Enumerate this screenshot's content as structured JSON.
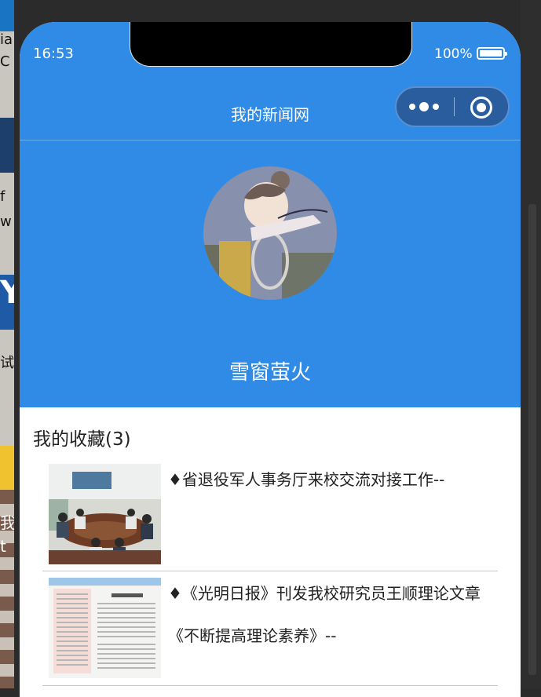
{
  "status_bar": {
    "time": "16:53",
    "battery": "100%"
  },
  "nav": {
    "title": "我的新闻网"
  },
  "profile": {
    "username": "雪窗萤火"
  },
  "favorites": {
    "title": "我的收藏(3)",
    "items": [
      {
        "title": "♦省退役军人事务厅来校交流对接工作--"
      },
      {
        "title": "♦《光明日报》刊发我校研究员王顺理论文章《不断提高理论素养》--"
      }
    ]
  },
  "desktop_fragments": [
    "ia",
    "C",
    "f",
    "w",
    "Y",
    "试",
    "我",
    "t"
  ]
}
